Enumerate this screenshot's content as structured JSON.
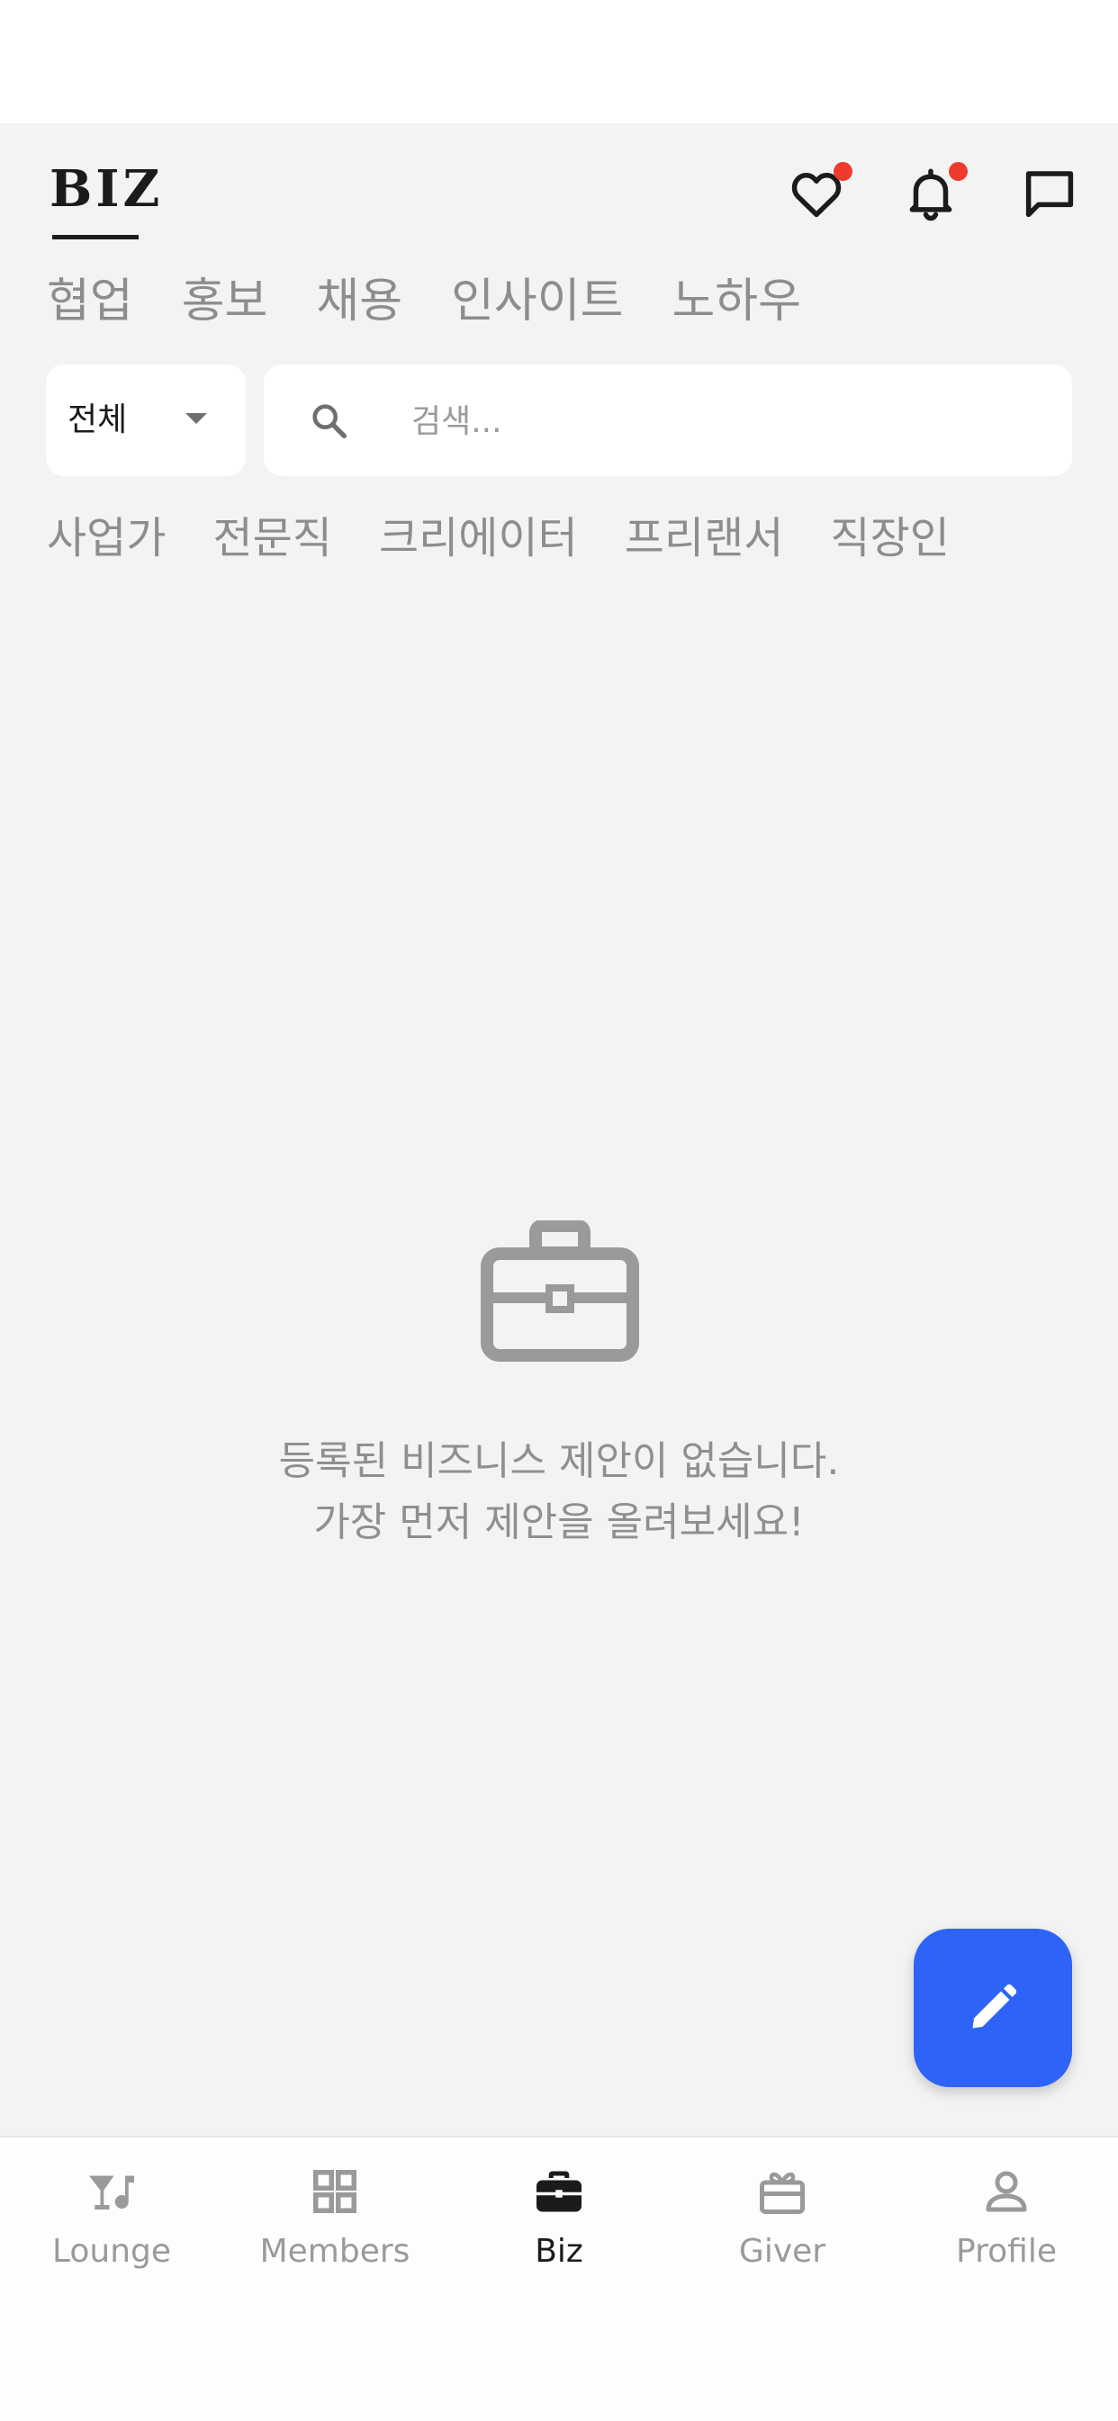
{
  "header": {
    "logo": "BIZ"
  },
  "category_tabs": [
    "협업",
    "홍보",
    "채용",
    "인사이트",
    "노하우"
  ],
  "filter": {
    "selected": "전체"
  },
  "search": {
    "placeholder": "검색..."
  },
  "sub_tabs": [
    "사업가",
    "전문직",
    "크리에이터",
    "프리랜서",
    "직장인"
  ],
  "empty_state": {
    "line1": "등록된 비즈니스 제안이 없습니다.",
    "line2": "가장 먼저 제안을 올려보세요!"
  },
  "bottom_nav": [
    {
      "label": "Lounge",
      "icon": "cocktail-music-icon",
      "active": false
    },
    {
      "label": "Members",
      "icon": "grid-icon",
      "active": false
    },
    {
      "label": "Biz",
      "icon": "briefcase-icon",
      "active": true
    },
    {
      "label": "Giver",
      "icon": "gift-icon",
      "active": false
    },
    {
      "label": "Profile",
      "icon": "person-icon",
      "active": false
    }
  ],
  "colors": {
    "accent": "#2d64f7",
    "badge": "#ef3b2d",
    "text_muted": "#8d8d8d",
    "text_dark": "#1b1b1b"
  }
}
